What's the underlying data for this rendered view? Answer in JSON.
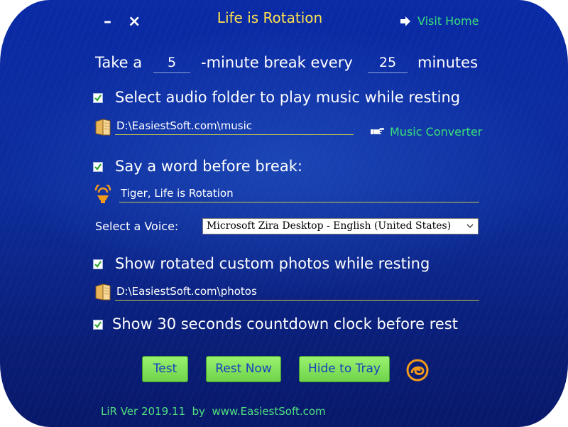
{
  "window": {
    "title": "Life is Rotation",
    "minimize_label": "–",
    "close_label": "×",
    "visit_home_label": "Visit Home"
  },
  "break_row": {
    "prefix": "Take a",
    "break_minutes": "5",
    "middle": "-minute break every",
    "interval_minutes": "25",
    "suffix": "minutes"
  },
  "audio": {
    "checked": true,
    "label": "Select audio folder to play music while resting",
    "folder_path": "D:\\EasiestSoft.com\\music",
    "music_converter_label": "Music Converter"
  },
  "say_word": {
    "checked": true,
    "label": "Say a word before break:",
    "text": "Tiger, Life is Rotation",
    "voice_label": "Select a Voice:",
    "voice_selected": "Microsoft Zira Desktop - English (United States)"
  },
  "photos": {
    "checked": true,
    "label": "Show rotated custom photos while resting",
    "folder_path": "D:\\EasiestSoft.com\\photos"
  },
  "countdown": {
    "checked": true,
    "label": "Show 30 seconds countdown clock before rest"
  },
  "buttons": {
    "test": "Test",
    "rest_now": "Rest Now",
    "hide_to_tray": "Hide to Tray"
  },
  "footer": {
    "text": "LiR Ver 2019.11  by  www.EasiestSoft.com"
  },
  "icons": {
    "folder": "folder-icon",
    "speaker": "speaker-icon",
    "arrow": "arrow-right-icon",
    "pointing_hand": "pointing-hand-icon",
    "logo": "app-logo-icon"
  },
  "colors": {
    "title": "#ffe34d",
    "link": "#39e07a",
    "button_fill": "#7fe35a",
    "button_text": "#1a3fbd",
    "window_bg": "#0d2d9c"
  }
}
